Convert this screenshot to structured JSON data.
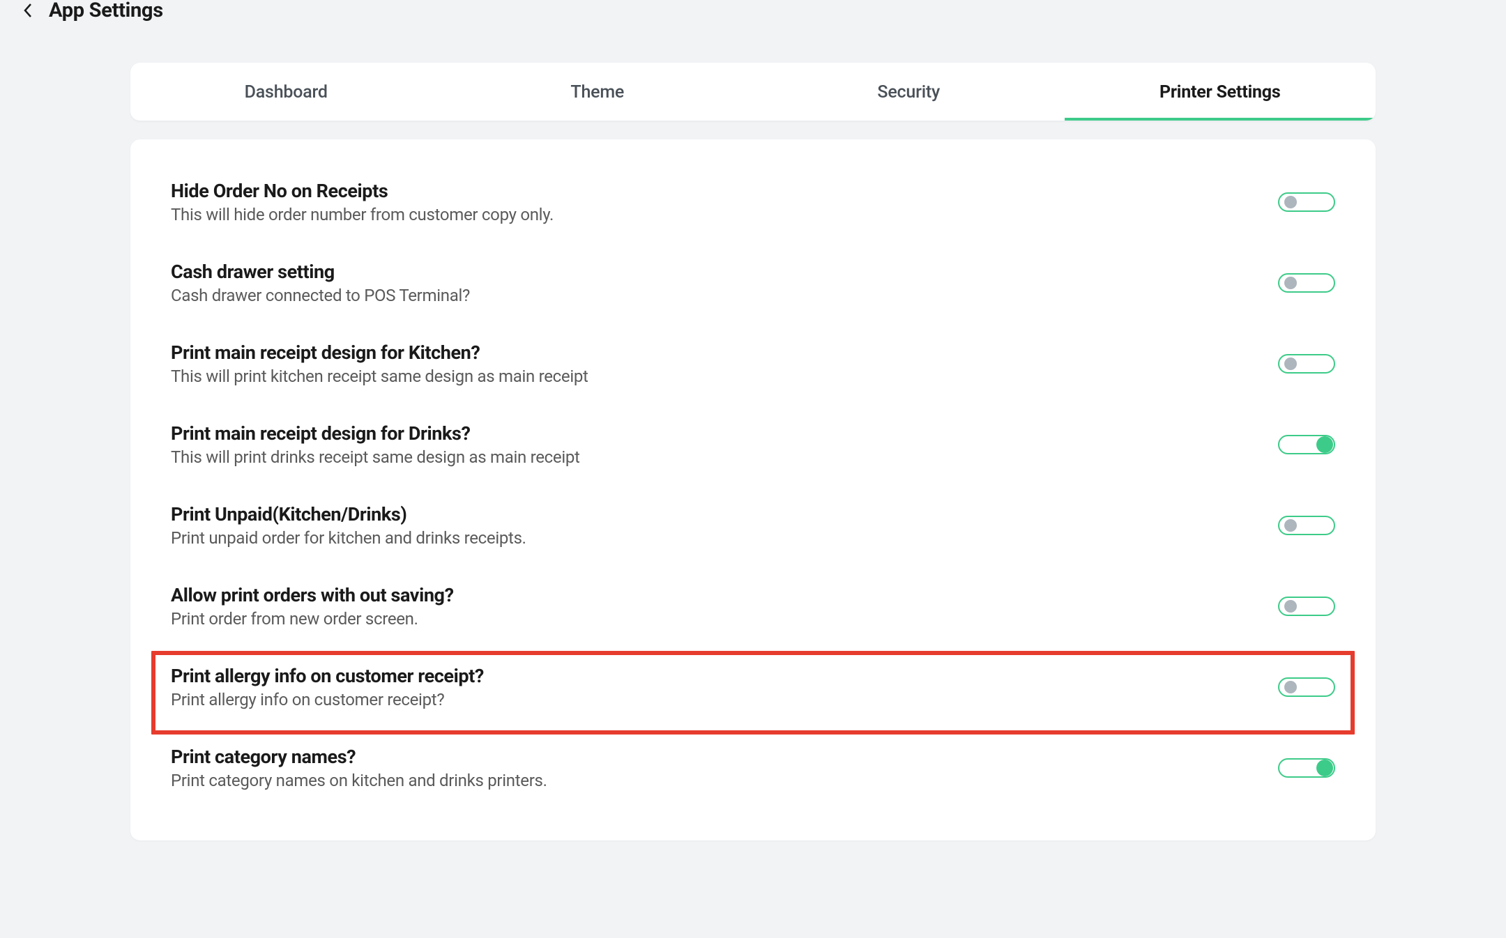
{
  "header": {
    "title": "App Settings"
  },
  "tabs": [
    {
      "label": "Dashboard",
      "active": false
    },
    {
      "label": "Theme",
      "active": false
    },
    {
      "label": "Security",
      "active": false
    },
    {
      "label": "Printer Settings",
      "active": true
    }
  ],
  "settings": [
    {
      "id": "hide-order-no",
      "title": "Hide Order No on Receipts",
      "desc": "This will hide order number from customer copy only.",
      "on": false,
      "highlight": false
    },
    {
      "id": "cash-drawer",
      "title": "Cash drawer setting",
      "desc": "Cash drawer connected to POS Terminal?",
      "on": false,
      "highlight": false
    },
    {
      "id": "kitchen-design",
      "title": "Print main receipt design for Kitchen?",
      "desc": "This will print kitchen receipt same design as main receipt",
      "on": false,
      "highlight": false
    },
    {
      "id": "drinks-design",
      "title": "Print main receipt design for Drinks?",
      "desc": "This will print drinks receipt same design as main receipt",
      "on": true,
      "highlight": false
    },
    {
      "id": "print-unpaid",
      "title": "Print Unpaid(Kitchen/Drinks)",
      "desc": "Print unpaid order for kitchen and drinks receipts.",
      "on": false,
      "highlight": false
    },
    {
      "id": "print-without-save",
      "title": "Allow print orders with out saving?",
      "desc": "Print order from new order screen.",
      "on": false,
      "highlight": false
    },
    {
      "id": "print-allergy",
      "title": "Print allergy info on customer receipt?",
      "desc": "Print allergy info on customer receipt?",
      "on": false,
      "highlight": true
    },
    {
      "id": "print-category",
      "title": "Print category names?",
      "desc": "Print category names on kitchen and drinks printers.",
      "on": true,
      "highlight": false
    }
  ]
}
